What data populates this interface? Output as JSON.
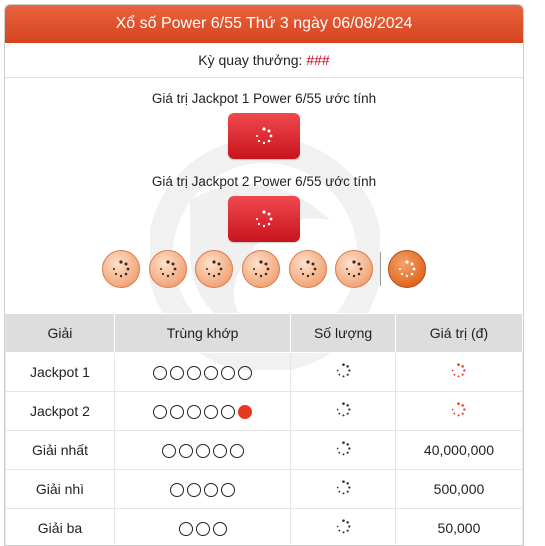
{
  "header": {
    "title": "Xổ số Power 6/55 Thứ 3 ngày 06/08/2024"
  },
  "draw": {
    "label": "Kỳ quay thưởng: ",
    "number": "###"
  },
  "jackpot1": {
    "label": "Giá trị Jackpot 1 Power 6/55 ước tính"
  },
  "jackpot2": {
    "label": "Giá trị Jackpot 2 Power 6/55 ước tính"
  },
  "balls": {
    "count": 6,
    "power_ball": true,
    "icon": "loading-spinner-icon"
  },
  "table": {
    "headers": [
      "Giải",
      "Trùng khớp",
      "Số lượng",
      "Giá trị (đ)"
    ],
    "rows": [
      {
        "prize": "Jackpot 1",
        "matches": 6,
        "power": false,
        "value": ""
      },
      {
        "prize": "Jackpot 2",
        "matches": 5,
        "power": true,
        "value": ""
      },
      {
        "prize": "Giải nhất",
        "matches": 5,
        "power": false,
        "value": "40,000,000"
      },
      {
        "prize": "Giải nhì",
        "matches": 4,
        "power": false,
        "value": "500,000"
      },
      {
        "prize": "Giải ba",
        "matches": 3,
        "power": false,
        "value": "50,000"
      }
    ]
  },
  "colors": {
    "header": "#d94a23",
    "jackpot": "#e12a31",
    "power_ball": "#e06a23",
    "match_red": "#e63a1e"
  }
}
